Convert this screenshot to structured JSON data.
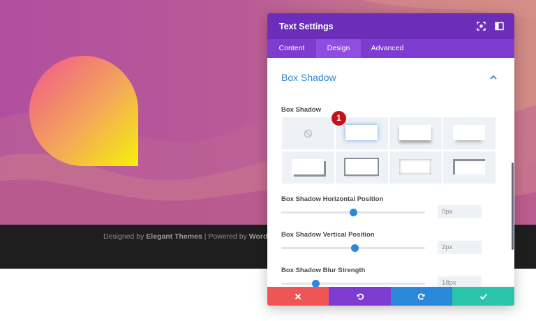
{
  "footer": {
    "designed_by": "Designed by",
    "elegant_themes": "Elegant Themes",
    "separator": "|",
    "powered_by": "Powered by",
    "wordpress": "WordPress"
  },
  "modal": {
    "title": "Text Settings",
    "header_icons": [
      "fullscreen-icon",
      "split-view-icon"
    ],
    "tabs": [
      {
        "label": "Content",
        "active": false
      },
      {
        "label": "Design",
        "active": true
      },
      {
        "label": "Advanced",
        "active": false
      }
    ],
    "section": {
      "title": "Box Shadow",
      "box_shadow_label": "Box Shadow",
      "step_badge": "1",
      "presets": [
        "none",
        "preset-1",
        "preset-2",
        "preset-3",
        "preset-4",
        "preset-5",
        "preset-6",
        "preset-7"
      ],
      "sliders": [
        {
          "label": "Box Shadow Horizontal Position",
          "value": "0px",
          "fraction": 0.5
        },
        {
          "label": "Box Shadow Vertical Position",
          "value": "2px",
          "fraction": 0.51
        },
        {
          "label": "Box Shadow Blur Strength",
          "value": "18px",
          "fraction": 0.24
        }
      ]
    },
    "footer_buttons": [
      {
        "name": "cancel",
        "icon": "close-icon",
        "color": "#ef5555"
      },
      {
        "name": "undo",
        "icon": "undo-icon",
        "color": "#7e3bd0"
      },
      {
        "name": "redo",
        "icon": "redo-icon",
        "color": "#2b87da"
      },
      {
        "name": "save",
        "icon": "check-icon",
        "color": "#29c4a9"
      }
    ]
  },
  "colors": {
    "header": "#6c2eb9",
    "tabs": "#7e3bd0",
    "accent": "#2b87da",
    "badge": "#c4121b"
  }
}
